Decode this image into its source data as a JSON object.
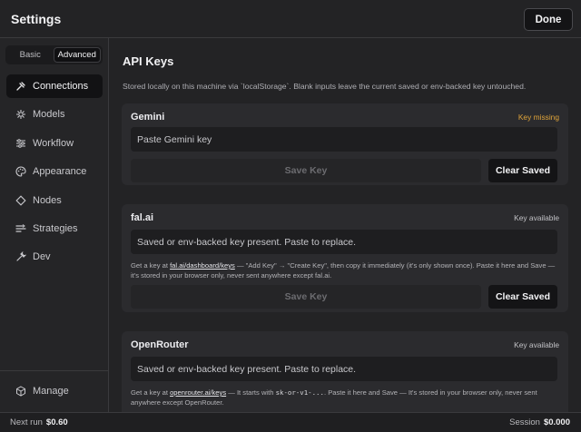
{
  "header": {
    "title": "Settings",
    "done_label": "Done"
  },
  "sidebar": {
    "modes": [
      "Basic",
      "Advanced"
    ],
    "active_mode": "Advanced",
    "items": [
      {
        "label": "Connections",
        "icon": "connections-icon",
        "active": true
      },
      {
        "label": "Models",
        "icon": "models-icon"
      },
      {
        "label": "Workflow",
        "icon": "workflow-icon"
      },
      {
        "label": "Appearance",
        "icon": "palette-icon"
      },
      {
        "label": "Nodes",
        "icon": "diamond-icon"
      },
      {
        "label": "Strategies",
        "icon": "strategies-icon"
      },
      {
        "label": "Dev",
        "icon": "wrench-icon"
      }
    ],
    "manage_label": "Manage"
  },
  "section": {
    "title": "API Keys",
    "description": "Stored locally on this machine via `localStorage`. Blank inputs leave the current saved or env-backed key untouched."
  },
  "providers": [
    {
      "name": "Gemini",
      "status": "Key missing",
      "placeholder": "Paste Gemini key",
      "save_label": "Save Key",
      "clear_label": "Clear Saved"
    },
    {
      "name": "fal.ai",
      "status": "Key available",
      "placeholder": "Saved or env-backed key present. Paste to replace.",
      "hint_prefix": "Get a key at ",
      "hint_link": "fal.ai/dashboard/keys",
      "hint_suffix": " — \"Add Key\" → \"Create Key\", then copy it immediately (it's only shown once). Paste it here and Save — it's stored in your browser only, never sent anywhere except fal.ai.",
      "save_label": "Save Key",
      "clear_label": "Clear Saved"
    },
    {
      "name": "OpenRouter",
      "status": "Key available",
      "placeholder": "Saved or env-backed key present. Paste to replace.",
      "hint_prefix": "Get a key at ",
      "hint_link": "openrouter.ai/keys",
      "hint_mid": " — It starts with ",
      "hint_code": "sk-or-v1-...",
      "hint_suffix": ". Paste it here and Save — It's stored in your browser only, never sent anywhere except OpenRouter."
    }
  ],
  "footer": {
    "next_run_label": "Next run",
    "next_run_value": "$0.60",
    "session_label": "Session",
    "session_value": "$0.000"
  },
  "colors": {
    "background": "#232325",
    "card": "#2b2b2e",
    "warning": "#e0a43a",
    "active_nav": "#121214"
  }
}
